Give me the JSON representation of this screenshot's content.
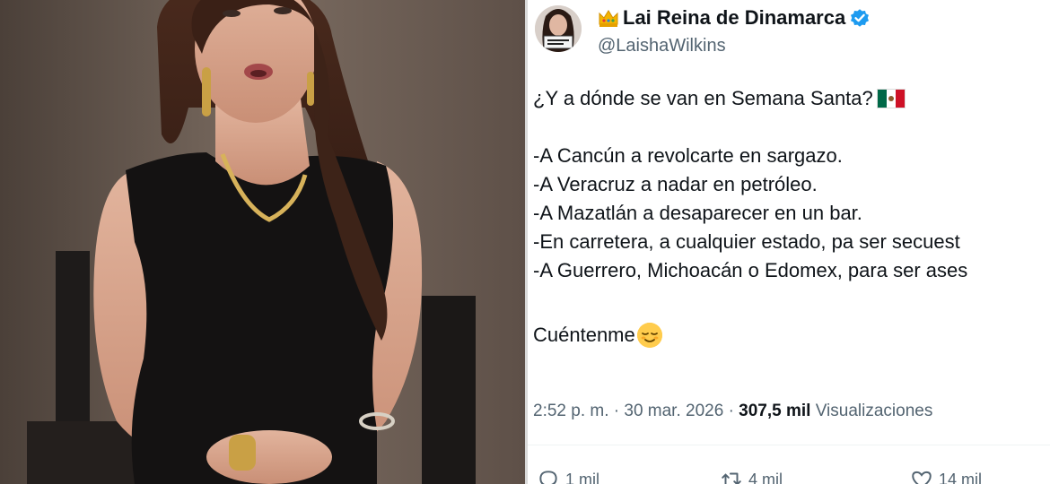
{
  "tweet": {
    "display_name": "Lai Reina de Dinamarca",
    "handle": "@LaishaWilkins",
    "lines": [
      "¿Y a dónde se van en Semana Santa?",
      "-A Cancún a revolcarte en sargazo.",
      "-A Veracruz a nadar en petróleo.",
      "-A Mazatlán a desaparecer en un bar.",
      "-En carretera, a cualquier estado, pa ser secuest",
      "-A Guerrero, Michoacán o Edomex, para ser ases",
      "Cuéntenme"
    ],
    "time": "2:52 p. m. · 30 mar. 2026 · ",
    "views_count": "307,5 mil",
    "views_label": " Visualizaciones",
    "actions": {
      "replies": "1 mil",
      "reposts": "4 mil",
      "likes": "14 mil"
    }
  },
  "icons": [
    "crown-emoji-icon",
    "verified-badge-icon",
    "mexico-flag-icon",
    "relieved-face-emoji-icon",
    "reply-icon",
    "repost-icon",
    "like-icon"
  ],
  "colors": {
    "verified": "#1d9bf0",
    "text": "#0f1419",
    "secondary": "#536471"
  }
}
